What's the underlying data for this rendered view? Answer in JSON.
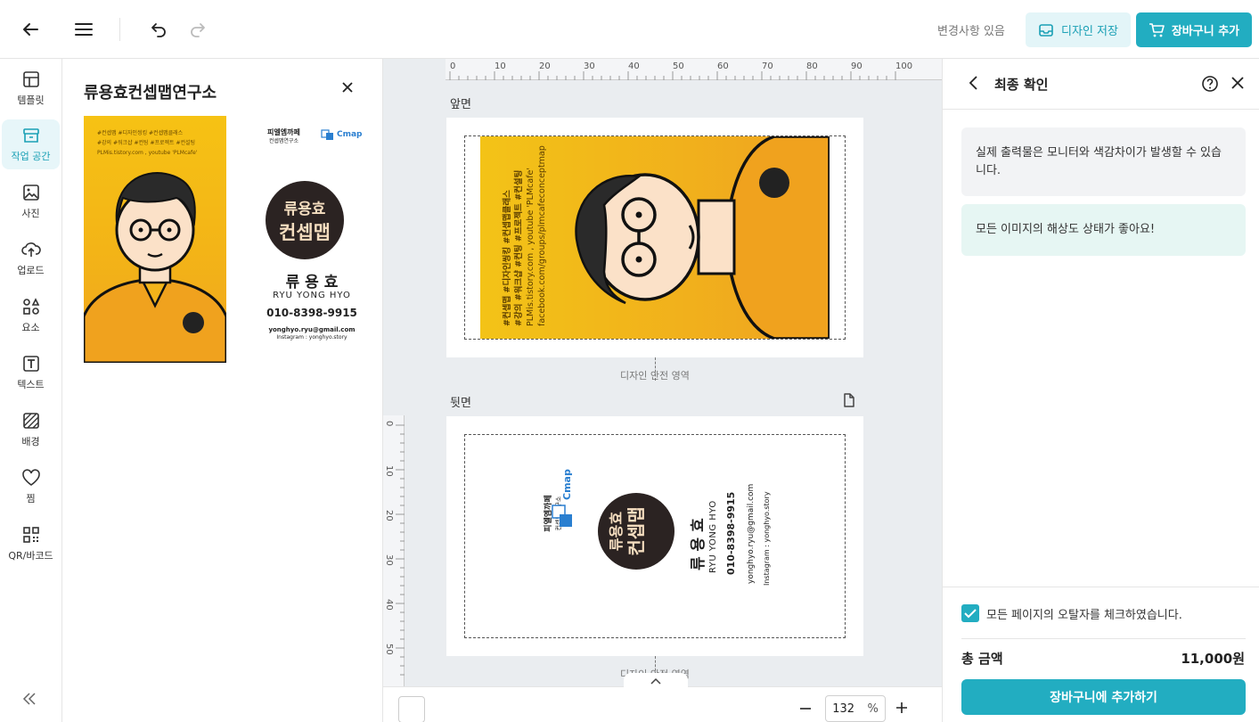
{
  "topbar": {
    "changes_status": "변경사항 있음",
    "save_label": "디자인 저장",
    "cart_label": "장바구니 추가"
  },
  "rail": {
    "items": [
      {
        "label": "템플릿",
        "icon": "template-icon"
      },
      {
        "label": "작업 공간",
        "icon": "workspace-icon"
      },
      {
        "label": "사진",
        "icon": "photo-icon"
      },
      {
        "label": "업로드",
        "icon": "upload-icon"
      },
      {
        "label": "요소",
        "icon": "elements-icon"
      },
      {
        "label": "텍스트",
        "icon": "text-icon"
      },
      {
        "label": "배경",
        "icon": "background-icon"
      },
      {
        "label": "찜",
        "icon": "heart-icon"
      },
      {
        "label": "QR/바코드",
        "icon": "qr-icon"
      }
    ],
    "active": "작업 공간"
  },
  "side": {
    "title": "류용효컨셉맵연구소",
    "thumb_tags": [
      "#컨셉맵 #디자인씽킹 #컨셉맵클래스",
      "#강의 #워크샵 #컨팅 #프로젝트 #컨설팅",
      "PLMis.tistory.com , youtube 'PLMcafe'"
    ],
    "org_name": "피엘엠까페",
    "org_sub": "컨셉맵연구소",
    "cmap": "Cmap",
    "logo_line1": "류용효",
    "logo_line2": "컨셉맵",
    "name": "류 용 효",
    "name_en": "RYU YONG HYO",
    "phone": "010-8398-9915",
    "email": "yonghyo.ryu@gmail.com",
    "instagram": "Instagram : yonghyo.story"
  },
  "canvas": {
    "ruler_top": [
      "0",
      "10",
      "20",
      "30",
      "40",
      "50",
      "60",
      "70",
      "80",
      "90",
      "100"
    ],
    "ruler_left": [
      "0",
      "10",
      "20",
      "30",
      "40",
      "50"
    ],
    "front_label": "앞면",
    "back_label": "뒷면",
    "safe_area": "디자인 안전 영역",
    "front_text": [
      "#컨셉맵 #디자인씽킹 #컨셉맵클래스",
      "#강의 #워크샵 #컨팅 #프로젝트 #컨설팅",
      "PLMis.tistory.com , youtube 'PLMcafe'",
      "facebook.com/groups/plmcafeconceptmap"
    ],
    "zoom": "132",
    "zoom_unit": "%"
  },
  "right": {
    "title": "최종 확인",
    "notice_monitor": "실제 출력물은 모니터와 색감차이가 발생할 수 있습니다.",
    "notice_resolution": "모든 이미지의 해상도 상태가 좋아요!",
    "check_label": "모든 페이지의 오탈자를 체크하였습니다.",
    "total_label": "총 금액",
    "total_value": "11,000원",
    "add_button": "장바구니에 추가하기"
  },
  "colors": {
    "accent": "#22adc1",
    "card_yellow": "#f3b417"
  }
}
